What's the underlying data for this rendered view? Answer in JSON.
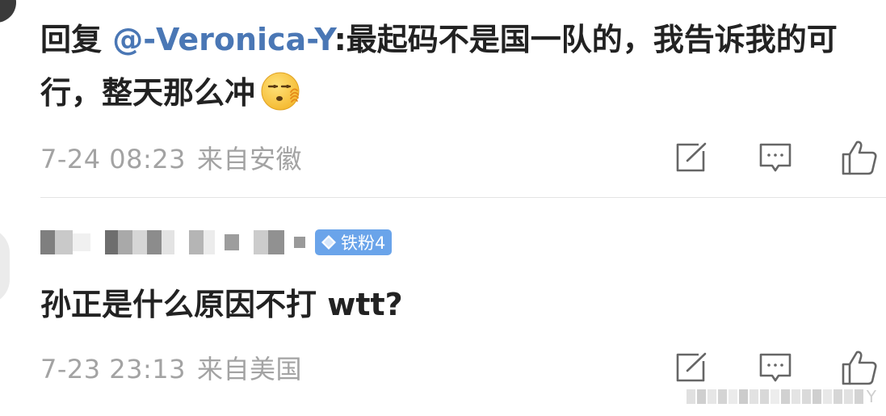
{
  "comments": [
    {
      "reply_prefix": "回复 ",
      "mention": "@-Veronica-Y",
      "text": ":最起码不是国一队的，我告诉我的可行，整天那么冲",
      "emoji": "smirk-face-emoji",
      "date": "7-24 08:23",
      "source": "来自安徽"
    },
    {
      "username": "",
      "badge": "铁粉4",
      "text": "孙正是什么原因不打 wtt?",
      "date": "7-23 23:13",
      "source": "来自美国"
    }
  ],
  "icons": {
    "share": "share-edit-icon",
    "comment": "comment-bubble-icon",
    "like": "thumbs-up-icon"
  },
  "colors": {
    "mention": "#4a77b5",
    "meta": "#a3a3a3",
    "badge": "#6aa4ea",
    "icon": "#666666"
  },
  "watermark": "Y"
}
